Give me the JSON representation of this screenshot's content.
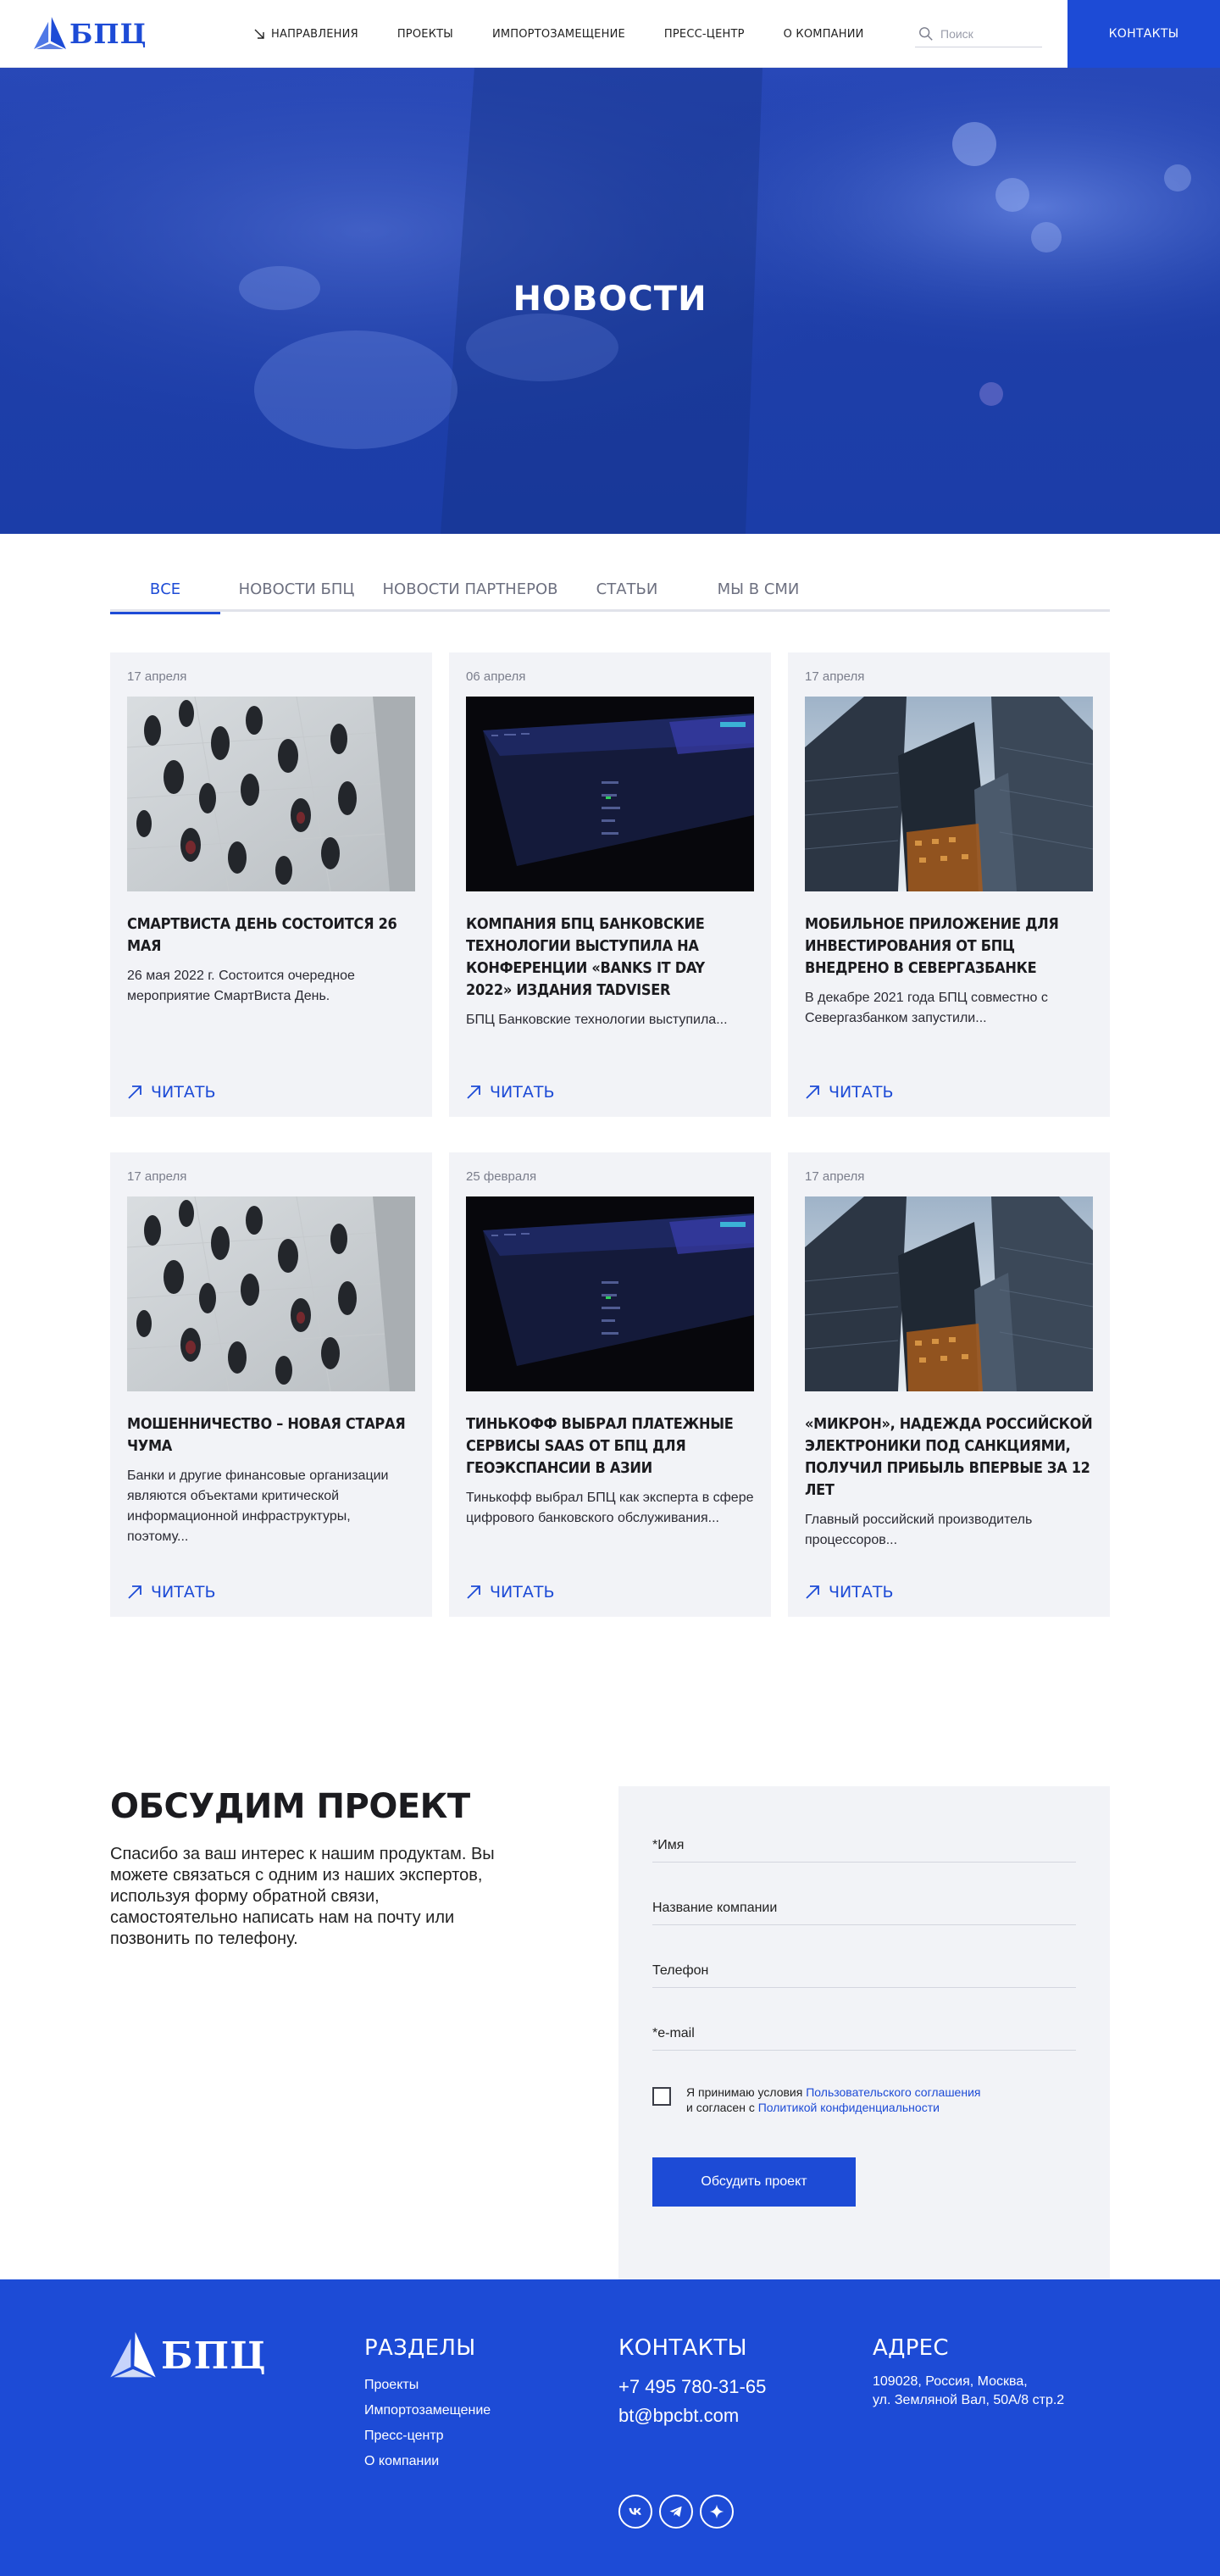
{
  "header": {
    "logo_text": "БПЦ",
    "nav": [
      {
        "label": "Направления"
      },
      {
        "label": "Проекты"
      },
      {
        "label": "Импортозамещение"
      },
      {
        "label": "Пресс-центр"
      },
      {
        "label": "О компании"
      }
    ],
    "search_placeholder": "Поиск",
    "contacts_label": "Контакты"
  },
  "hero": {
    "title": "Новости"
  },
  "tabs": [
    {
      "label": "Все",
      "active": true
    },
    {
      "label": "Новости БПЦ",
      "active": false
    },
    {
      "label": "Новости партнеров",
      "active": false
    },
    {
      "label": "Статьи",
      "active": false
    },
    {
      "label": "Мы в СМИ",
      "active": false
    }
  ],
  "news": [
    {
      "date": "17 апреля",
      "image": "crowd",
      "title": "СмартВиста День состоится 26 мая",
      "text": "26 мая 2022 г. Состоится очередное мероприятие СмартВиста День.",
      "more": "Читать"
    },
    {
      "date": "06 апреля",
      "image": "screen",
      "title": "Компания БПЦ Банковские технологии выступила на конференции «Banks IT Day 2022» издания Tadviser",
      "text": "БПЦ Банковские технологии выступила...",
      "more": "Читать"
    },
    {
      "date": "17 апреля",
      "image": "towers",
      "title": "Мобильное приложение для инвестирования от БПЦ внедрено в Севергазбанке",
      "text": "В декабре 2021 года БПЦ совместно с Севергазбанком запустили...",
      "more": "Читать"
    },
    {
      "date": "17 апреля",
      "image": "crowd",
      "title": "Мошенничество – новая старая чума",
      "text": "Банки и другие финансовые организации являются объектами критической информационной инфраструктуры, поэтому...",
      "more": "Читать"
    },
    {
      "date": "25 февраля",
      "image": "screen",
      "title": "Тинькофф выбрал платежные сервисы SaaS от БПЦ для геоэкспансии в Азии",
      "text": "Тинькофф выбрал БПЦ как эксперта в сфере цифрового банковского обслуживания...",
      "more": "Читать"
    },
    {
      "date": "17 апреля",
      "image": "towers",
      "title": "«Микрон», надежда российской электроники под санкциями, получил прибыль впервые за 12 лет",
      "text": "Главный российский производитель процессоров...",
      "more": "Читать"
    }
  ],
  "discuss": {
    "title": "Обсудим проект",
    "text": "Спасибо за ваш интерес к нашим продуктам. Вы можете связаться с одним из наших экспертов, используя форму обратной связи, самостоятельно написать нам на почту или позвонить по телефону.",
    "fields": {
      "name": "*Имя",
      "company": "Название компании",
      "phone": "Телефон",
      "email": "*e-mail"
    },
    "consent": {
      "pre": "Я принимаю условия ",
      "link1": "Пользовательского соглашения",
      "mid": "и согласен с ",
      "link2": "Политикой конфиденциальности"
    },
    "submit": "Обсудить проект"
  },
  "footer": {
    "logo_text": "БПЦ",
    "sections": {
      "title": "Разделы",
      "links": [
        "Проекты",
        "Импортозамещение",
        "Пресс-центр",
        "О компании"
      ]
    },
    "contacts": {
      "title": "Контакты",
      "phone": "+7 495 780-31-65",
      "email": "bt@bpcbt.com"
    },
    "address": {
      "title": "Адрес",
      "line1": "109028, Россия, Москва,",
      "line2": "ул. Земляной Вал, 50А/8 стр.2"
    },
    "socials": [
      "vk-icon",
      "telegram-icon",
      "sparkle-icon"
    ]
  },
  "colors": {
    "brand": "#1d4bd6",
    "card_bg": "#f2f3f7",
    "text": "#1b1b1f",
    "muted": "#7b7e8c"
  }
}
